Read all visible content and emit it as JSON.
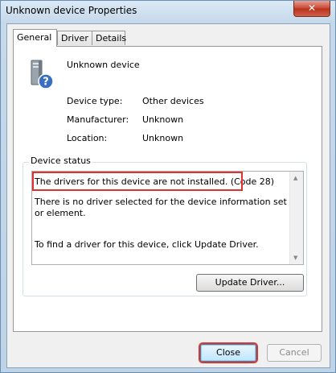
{
  "window": {
    "title": "Unknown device Properties",
    "close_glyph": "✕"
  },
  "tabs": [
    {
      "label": "General"
    },
    {
      "label": "Driver"
    },
    {
      "label": "Details"
    }
  ],
  "device": {
    "name": "Unknown device",
    "icon": "unknown-device-icon",
    "properties": [
      {
        "label": "Device type:",
        "value": "Other devices"
      },
      {
        "label": "Manufacturer:",
        "value": "Unknown"
      },
      {
        "label": "Location:",
        "value": "Unknown"
      }
    ]
  },
  "status": {
    "group_label": "Device status",
    "line1": "The drivers for this device are not installed. (Code 28)",
    "line2": "There is no driver selected for the device information set or element.",
    "line3": "To find a driver for this device, click Update Driver."
  },
  "buttons": {
    "update_driver": "Update Driver...",
    "close": "Close",
    "cancel": "Cancel"
  },
  "colors": {
    "highlight": "#e0332d",
    "title_bar": "#c9dcec"
  }
}
